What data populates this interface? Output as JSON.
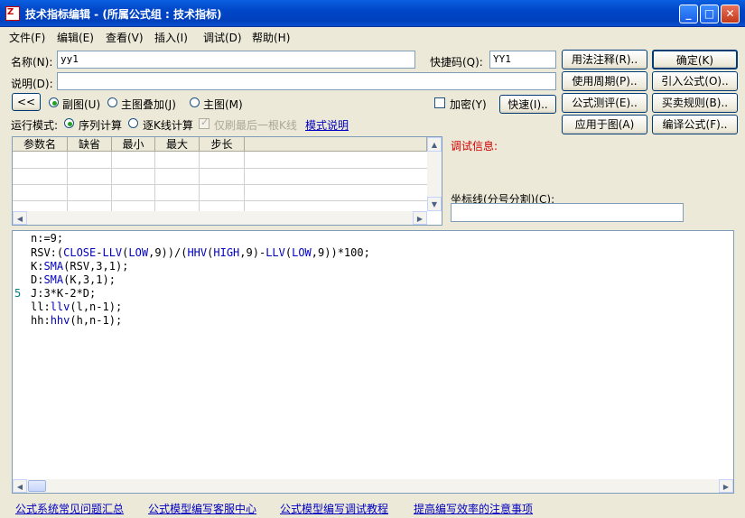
{
  "window": {
    "title": "技术指标编辑 - (所属公式组 : 技术指标)",
    "app_icon": "chart-app-icon",
    "minimize": "_",
    "maximize": "□",
    "close": "✕"
  },
  "menu": [
    "文件(F)",
    "编辑(E)",
    "查看(V)",
    "插入(I)",
    "调试(D)",
    "帮助(H)"
  ],
  "form": {
    "name_label": "名称(N):",
    "name_value": "yy1",
    "shortcut_label": "快捷码(Q):",
    "shortcut_value": "YY1",
    "desc_label": "说明(D):",
    "desc_value": "",
    "collapse_btn": "<<",
    "radio_sub": "副图(U)",
    "radio_overlay": "主图叠加(J)",
    "radio_main": "主图(M)",
    "encrypt": "加密(Y)",
    "quick_btn": "快速(I)..",
    "mode_label": "运行模式:",
    "mode_seq": "序列计算",
    "mode_kline": "逐K线计算",
    "mode_last": "仅刷最后一根K线",
    "mode_link": "模式说明"
  },
  "right_buttons": {
    "usage": "用法注释(R)..",
    "ok": "确定(K)",
    "period": "使用周期(P)..",
    "import": "引入公式(O)..",
    "test": "公式测评(E)..",
    "trade": "买卖规则(B)..",
    "apply": "应用于图(A)",
    "compile": "编译公式(F).."
  },
  "params_table": {
    "headers": [
      "参数名",
      "缺省",
      "最小",
      "最大",
      "步长"
    ]
  },
  "debug": {
    "label": "调试信息:",
    "coord_label": "坐标线(分号分割)(C):",
    "coord_value": ""
  },
  "editor": {
    "marker_line": "5",
    "lines": [
      "n:=9;",
      "RSV:(CLOSE-LLV(LOW,9))/(HHV(HIGH,9)-LLV(LOW,9))*100;",
      "K:SMA(RSV,3,1);",
      "D:SMA(K,3,1);",
      "J:3*K-2*D;",
      "ll:llv(l,n-1);",
      "hh:hhv(h,n-1);"
    ]
  },
  "footer_links": [
    "公式系统常见问题汇总",
    "公式模型编写客服中心",
    "公式模型编写调试教程",
    "提高编写效率的注意事项"
  ]
}
